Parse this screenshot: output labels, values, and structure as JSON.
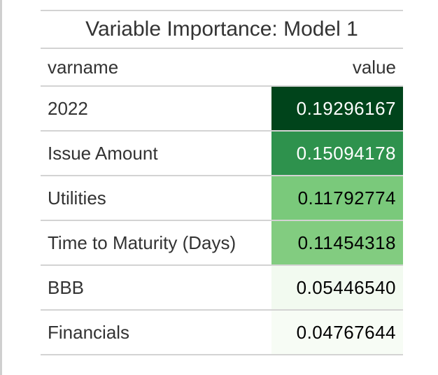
{
  "table": {
    "title": "Variable Importance: Model 1",
    "columns": [
      "varname",
      "value"
    ],
    "rows": [
      {
        "varname": "2022",
        "value": "0.19296167",
        "fill": "#00441b",
        "text_color": "#ffffff"
      },
      {
        "varname": "Issue Amount",
        "value": "0.15094178",
        "fill": "#2e924d",
        "text_color": "#ffffff"
      },
      {
        "varname": "Utilities",
        "value": "0.11792774",
        "fill": "#7ac97b",
        "text_color": "#000000"
      },
      {
        "varname": "Time to Maturity (Days)",
        "value": "0.11454318",
        "fill": "#82cc80",
        "text_color": "#000000"
      },
      {
        "varname": "BBB",
        "value": "0.05446540",
        "fill": "#f2faf0",
        "text_color": "#000000"
      },
      {
        "varname": "Financials",
        "value": "0.04767644",
        "fill": "#f7fcf5",
        "text_color": "#000000"
      }
    ]
  }
}
